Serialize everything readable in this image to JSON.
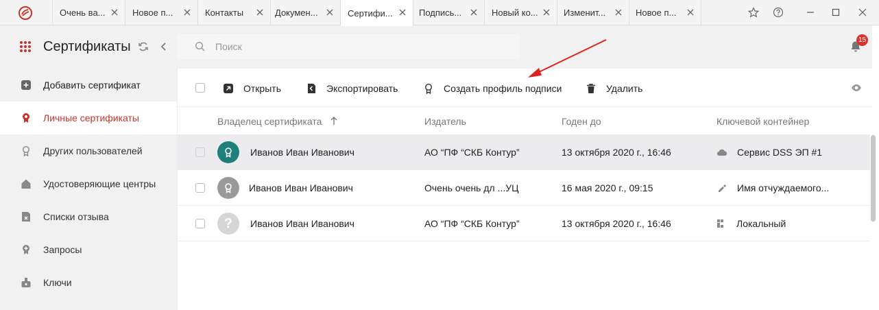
{
  "tabs": [
    {
      "label": "Очень ва..."
    },
    {
      "label": "Новое п..."
    },
    {
      "label": "Контакты"
    },
    {
      "label": "Докумен..."
    },
    {
      "label": "Сертифи..."
    },
    {
      "label": "Подпись..."
    },
    {
      "label": "Новый ко..."
    },
    {
      "label": "Изменит..."
    },
    {
      "label": "Новое п..."
    }
  ],
  "header": {
    "title": "Сертификаты",
    "search_placeholder": "Поиск",
    "notifications_count": "15"
  },
  "sidebar": {
    "items": [
      {
        "label": "Добавить сертификат",
        "icon": "plus-square-icon"
      },
      {
        "label": "Личные сертификаты",
        "icon": "badge-icon"
      },
      {
        "label": "Других пользователей",
        "icon": "badge-outline-icon"
      },
      {
        "label": "Удостоверяющие центры",
        "icon": "home-icon"
      },
      {
        "label": "Списки отзыва",
        "icon": "revocation-list-icon"
      },
      {
        "label": "Запросы",
        "icon": "request-icon"
      },
      {
        "label": "Ключи",
        "icon": "key-icon"
      }
    ]
  },
  "toolbar": {
    "open_label": "Открыть",
    "export_label": "Экспортировать",
    "create_profile_label": "Создать профиль подписи",
    "delete_label": "Удалить"
  },
  "table": {
    "columns": [
      "Владелец сертификата",
      "Издатель",
      "Годен до",
      "Ключевой контейнер"
    ],
    "rows": [
      {
        "owner": "Иванов Иван Иванович",
        "issuer": "АО “ПФ “СКБ Контур”",
        "valid_until": "13 октября 2020 г., 16:46",
        "container": "Сервис DSS ЭП #1",
        "avatar": "certificate-avatar-icon",
        "container_icon": "cloud-icon"
      },
      {
        "owner": "Иванов Иван Иванович",
        "issuer": "Очень очень дл ...УЦ",
        "valid_until": "16 мая 2020 г., 09:15",
        "container": "Имя отчуждаемого...",
        "avatar": "certificate-avatar-icon",
        "container_icon": "usb-token-icon"
      },
      {
        "owner": "Иванов Иван Иванович",
        "issuer": "АО “ПФ “СКБ Контур”",
        "valid_until": "13 октября 2020 г., 16:46",
        "container": "Локальный",
        "avatar": "unknown-avatar-icon",
        "container_icon": "local-storage-icon"
      }
    ]
  },
  "colors": {
    "accent": "#c7322a",
    "avatar_active": "#1f7f7a",
    "avatar_inactive": "#9a9a9a",
    "avatar_unknown": "#d6d6d6",
    "badge": "#d9342b",
    "annotation_arrow": "#e0201a"
  }
}
